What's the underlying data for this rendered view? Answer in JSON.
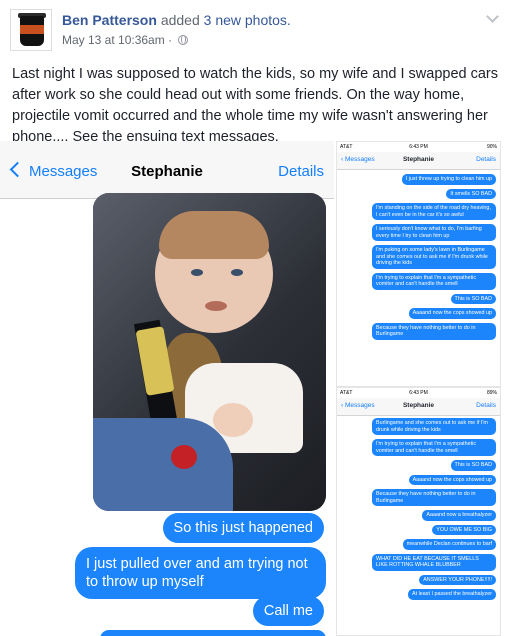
{
  "post": {
    "author": "Ben Patterson",
    "action": "added",
    "action_link": "3 new photos.",
    "timestamp": "May 13 at 10:36am",
    "separator": "·",
    "privacy_icon": "globe-icon",
    "text": "Last night I was supposed to watch the kids, so my wife and I swapped cars after work so she could head out with some friends. On the way home, projectile vomit occurred and the whole time my wife wasn't answering her phone.... See the ensuing text messages."
  },
  "big_screenshot": {
    "back_label": "Messages",
    "contact": "Stephanie",
    "details": "Details",
    "messages": [
      "So this just happened",
      "I just pulled over and am trying not to throw up myself",
      "Call me"
    ]
  },
  "small_screenshot_1": {
    "carrier": "AT&T",
    "time": "6:43 PM",
    "battery": "90%",
    "back_label": "Messages",
    "contact": "Stephanie",
    "details": "Details",
    "messages": [
      "I just threw up trying to clean him up",
      "It smells SO BAD",
      "I'm standing on the side of the road dry heaving, I can't even be in the car it's so awful",
      "I seriously don't know what to do, I'm barfing every time I try to clean him up",
      "I'm puking on some lady's lawn in Burlingame and she comes out to ask me if I'm drunk while driving the kids",
      "I'm trying to explain that I'm a sympathetic vomiter and can't handle the smell",
      "This is SO BAD",
      "Aaaand now the cops showed up",
      "Because they have nothing better to do in Burlingame"
    ]
  },
  "small_screenshot_2": {
    "carrier": "AT&T",
    "time": "6:43 PM",
    "battery": "89%",
    "back_label": "Messages",
    "contact": "Stephanie",
    "details": "Details",
    "messages": [
      "Burlingame and she comes out to ask me if I'm drunk while driving the kids",
      "I'm trying to explain that I'm a sympathetic vomiter and can't handle the smell",
      "This is SO BAD",
      "Aaaand now the cops showed up",
      "Because they have nothing better to do in Burlingame",
      "Aaaand now a breathalyzer",
      "YOU OWE ME SO BIG",
      "meanwhile Declan continues to barf",
      "WHAT DID HE EAT BECAUSE IT SMELLS LIKE ROTTING WHALE BLUBBER",
      "ANSWER YOUR PHONE!!!!!",
      "At least I passed the breathalyzer"
    ]
  }
}
